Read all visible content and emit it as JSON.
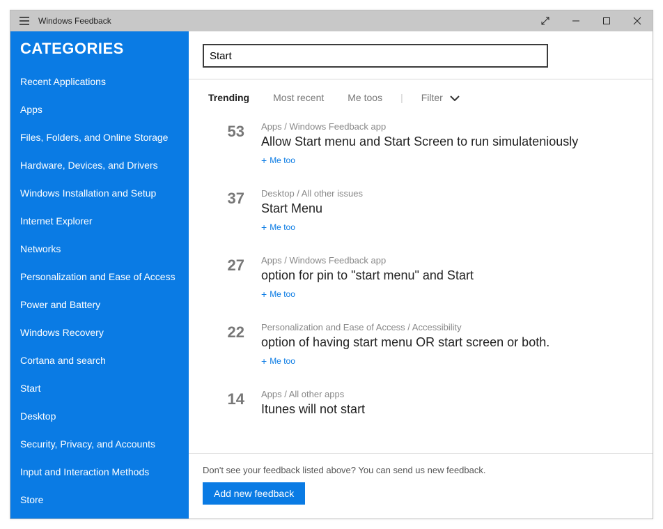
{
  "window": {
    "title": "Windows Feedback"
  },
  "sidebar": {
    "header": "CATEGORIES",
    "items": [
      "Recent Applications",
      "Apps",
      "Files, Folders, and Online Storage",
      "Hardware, Devices, and Drivers",
      "Windows Installation and Setup",
      "Internet Explorer",
      "Networks",
      "Personalization and Ease of Access",
      "Power and Battery",
      "Windows Recovery",
      "Cortana and search",
      "Start",
      "Desktop",
      "Security, Privacy, and Accounts",
      "Input and Interaction Methods",
      "Store"
    ]
  },
  "search": {
    "value": "Start"
  },
  "filter": {
    "tabs": [
      "Trending",
      "Most recent",
      "Me toos"
    ],
    "active_index": 0,
    "filter_label": "Filter"
  },
  "me_too_label": "Me too",
  "feedback": [
    {
      "count": "53",
      "category": "Apps / Windows Feedback app",
      "title": "Allow Start menu and Start Screen to run simulateniously"
    },
    {
      "count": "37",
      "category": "Desktop / All other issues",
      "title": "Start Menu"
    },
    {
      "count": "27",
      "category": "Apps / Windows Feedback app",
      "title": "option for pin to \"start menu\" and Start"
    },
    {
      "count": "22",
      "category": "Personalization and Ease of Access / Accessibility",
      "title": "option of having start menu OR start screen or both."
    },
    {
      "count": "14",
      "category": "Apps / All other apps",
      "title": "Itunes will not start"
    }
  ],
  "footer": {
    "prompt": "Don't see your feedback listed above? You can send us new feedback.",
    "button": "Add new feedback"
  }
}
